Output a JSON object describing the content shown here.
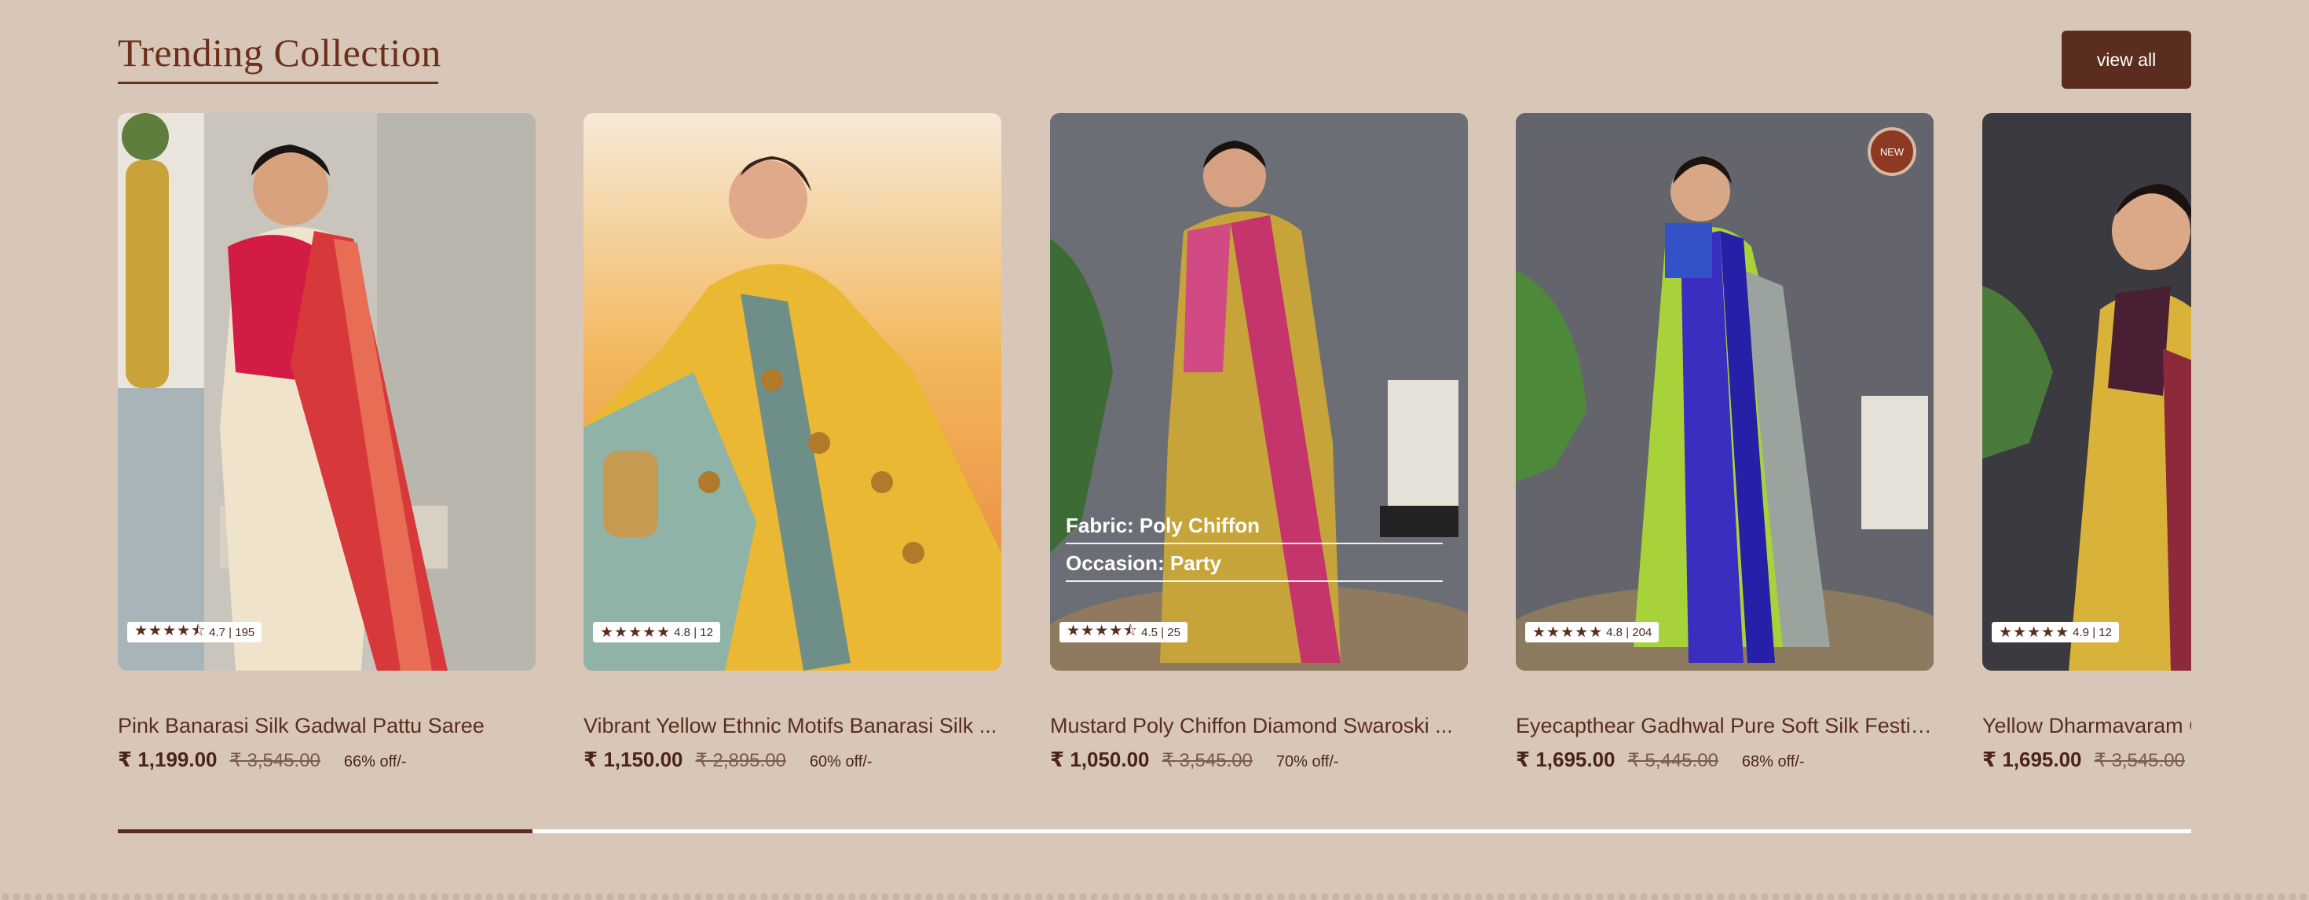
{
  "section": {
    "title": "Trending Collection",
    "view_all_label": "view all"
  },
  "products": [
    {
      "name": "Pink Banarasi Silk Gadwal Pattu Saree",
      "price": "₹ 1,199.00",
      "compare_price": "₹ 3,545.00",
      "discount": "66% off/-",
      "stars": "★★★★⯪",
      "rating_text": "4.7 | 195",
      "image": "pink-banarasi-saree-photo"
    },
    {
      "name": "Vibrant Yellow Ethnic Motifs Banarasi Silk ...",
      "price": "₹ 1,150.00",
      "compare_price": "₹ 2,895.00",
      "discount": "60% off/-",
      "stars": "★★★★★",
      "rating_text": "4.8 | 12",
      "image": "yellow-banarasi-saree-photo"
    },
    {
      "name": "Mustard Poly Chiffon Diamond Swaroski ...",
      "price": "₹ 1,050.00",
      "compare_price": "₹ 3,545.00",
      "discount": "70% off/-",
      "stars": "★★★★⯪",
      "rating_text": "4.5 | 25",
      "overlay_fabric": "Fabric: Poly Chiffon",
      "overlay_occasion": "Occasion: Party",
      "image": "mustard-chiffon-saree-photo"
    },
    {
      "name": "Eyecapthear Gadhwal Pure Soft Silk Festiv...",
      "price": "₹ 1,695.00",
      "compare_price": "₹ 5,445.00",
      "discount": "68% off/-",
      "stars": "★★★★★",
      "rating_text": "4.8 | 204",
      "badge": "NEW",
      "image": "green-blue-silk-saree-photo"
    },
    {
      "name": "Yellow Dharmavaram C",
      "price": "₹ 1,695.00",
      "compare_price": "₹ 3,545.00",
      "discount": "",
      "stars": "★★★★★",
      "rating_text": "4.9 | 12",
      "image": "yellow-dharmavaram-saree-photo"
    }
  ],
  "carousel": {
    "progress_fraction": 0.2
  },
  "colors": {
    "background": "#d8c7b9",
    "brand": "#5b2d1e",
    "title": "#6b2f1c"
  }
}
